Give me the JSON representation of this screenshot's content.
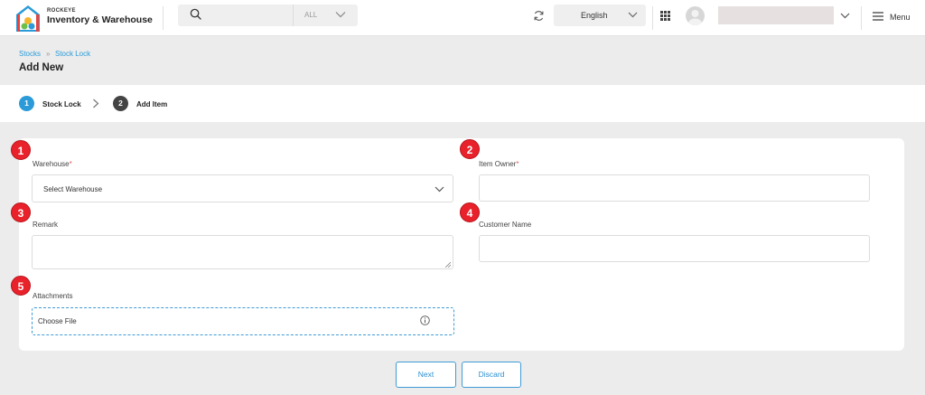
{
  "header": {
    "brand_small": "ROCKEYE",
    "brand_main": "Inventory & Warehouse",
    "search": {
      "scope": "ALL"
    },
    "language": "English",
    "menu_label": "Menu"
  },
  "breadcrumb": {
    "items": [
      "Stocks",
      "Stock Lock"
    ],
    "separator": "»"
  },
  "page_title": "Add New",
  "stepper": {
    "steps": [
      {
        "number": "1",
        "label": "Stock Lock",
        "active": true
      },
      {
        "number": "2",
        "label": "Add Item",
        "active": false
      }
    ],
    "active_color": "#2a9bd8",
    "inactive_color": "#444444"
  },
  "form": {
    "warehouse": {
      "label": "Warehouse",
      "required_mark": "*",
      "value": "Select Warehouse"
    },
    "item_owner": {
      "label": "Item Owner",
      "required_mark": "*"
    },
    "remark": {
      "label": "Remark"
    },
    "customer_name": {
      "label": "Customer Name"
    },
    "attachments": {
      "label": "Attachments",
      "button": "Choose File"
    }
  },
  "markers": [
    "1",
    "2",
    "3",
    "4",
    "5"
  ],
  "actions": {
    "next": "Next",
    "discard": "Discard"
  },
  "colors": {
    "accent": "#2a9bd8",
    "marker": "#e8212a"
  }
}
